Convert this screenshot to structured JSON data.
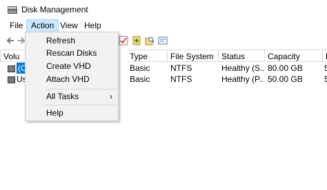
{
  "window": {
    "title": "Disk Management"
  },
  "menubar": {
    "items": [
      "File",
      "Action",
      "View",
      "Help"
    ]
  },
  "action_menu": {
    "items": [
      {
        "label": "Refresh"
      },
      {
        "label": "Rescan Disks"
      },
      {
        "label": "Create VHD"
      },
      {
        "label": "Attach VHD"
      },
      {
        "label": "All Tasks",
        "submenu_arrow": "›"
      },
      {
        "label": "Help"
      }
    ]
  },
  "table": {
    "columns": [
      "Volu",
      "Type",
      "File System",
      "Status",
      "Capacity",
      "F"
    ],
    "rows": [
      {
        "volume": "(C",
        "type": "Basic",
        "file_system": "NTFS",
        "status": "Healthy (S...",
        "capacity": "80.00 GB",
        "free": "5"
      },
      {
        "volume": "Us",
        "type": "Basic",
        "file_system": "NTFS",
        "status": "Healthy (P...",
        "capacity": "50.00 GB",
        "free": "5"
      }
    ]
  },
  "colors": {
    "menu_highlight": "#cce8ff",
    "menu_highlight_border": "#99d1ff",
    "selection": "#0078d7"
  }
}
